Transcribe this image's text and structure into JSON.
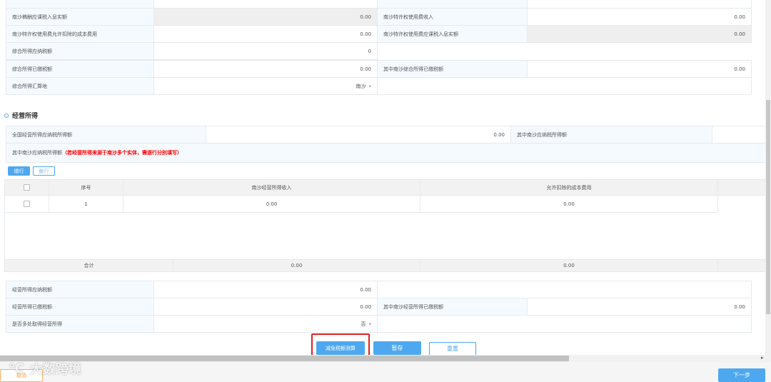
{
  "income_table": {
    "rows": [
      {
        "label": "南沙稿酬应课税入息实额",
        "value": "0.00",
        "right_label": "南沙特许权使用费收入",
        "right_value": "0.00"
      },
      {
        "label": "南沙特许权使用费允许扣除的成本费用",
        "value": "0.00",
        "right_label": "南沙特许权使用费应课税入息实额",
        "right_value": "0.00"
      },
      {
        "label": "综合所得应纳税额",
        "value": "0"
      },
      {
        "label": "综合所得已缴税额",
        "value": "0.00",
        "right_label": "其中南沙综合所得已缴税额",
        "right_value": "0.00"
      },
      {
        "label": "综合所得汇算地",
        "value": "南沙"
      }
    ]
  },
  "business": {
    "title": "经营所得",
    "national_label": "全国经营所得应纳税所得额",
    "national_value": "0.00",
    "nansha_label": "其中南沙应纳税所得额",
    "nansha_value": "",
    "note_label": "其中南沙应纳税所得额",
    "note_warning": "（若经营所得来源于南沙多个实体，需逐行分别填写）",
    "add_row": "增行",
    "delete_row": "删行",
    "columns": [
      "序号",
      "南沙经营所得收入",
      "允许扣除的成本费用"
    ],
    "rows": [
      {
        "index": "1",
        "income": "0.00",
        "cost": "0.00"
      }
    ],
    "total_label": "合计",
    "total_income": "0.00",
    "total_cost": "0.00",
    "tax_payable_label": "经营所得应纳税额",
    "tax_payable_value": "0.00",
    "tax_paid_label": "经营所得已缴税额",
    "tax_paid_value": "0.00",
    "nansha_paid_label": "其中南沙经营所得已缴税额",
    "nansha_paid_value": "0.00",
    "multi_label": "是否多处取得经营所得",
    "multi_value": "否"
  },
  "actions": {
    "calc": "减免税额测算",
    "save": "暂存",
    "reset": "重置"
  },
  "footer": {
    "cancel": "取消",
    "next": "下一步"
  },
  "watermark": "大数跨境",
  "colors": {
    "accent": "#4ea8f0",
    "warning": "#ff0000",
    "highlight_box": "#e02020"
  }
}
